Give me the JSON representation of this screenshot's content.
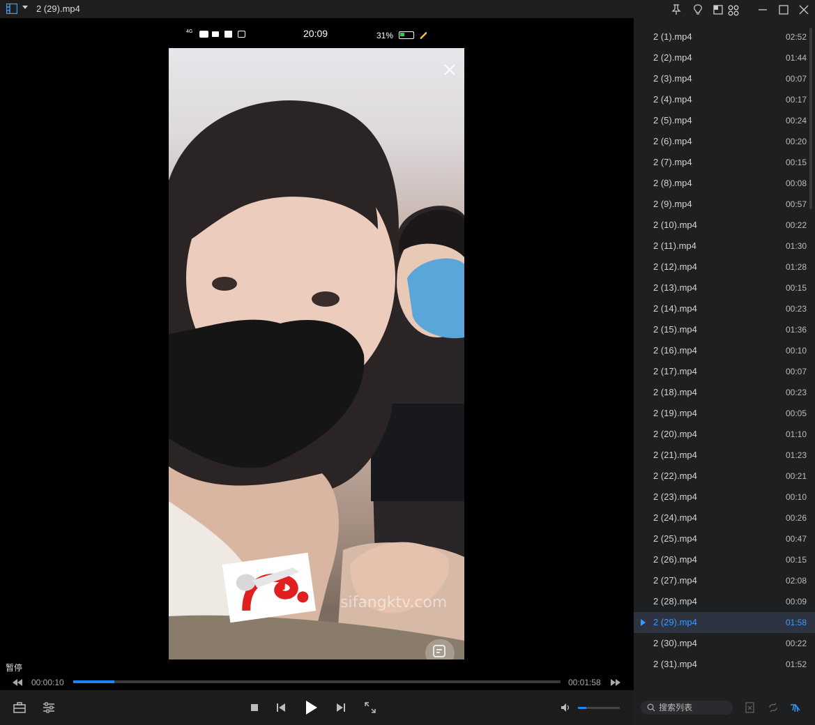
{
  "window": {
    "title": "2 (29).mp4"
  },
  "phone_status": {
    "network": "4G",
    "time": "20:09",
    "battery": "31%"
  },
  "video": {
    "watermark": "sifangktv.com"
  },
  "player": {
    "state_label": "暂停",
    "current_time": "00:00:10",
    "total_time": "00:01:58",
    "progress": 0.085,
    "volume": 0.2
  },
  "playlist": {
    "active_index": 28,
    "items": [
      {
        "name": "2 (1).mp4",
        "duration": "02:52"
      },
      {
        "name": "2 (2).mp4",
        "duration": "01:44"
      },
      {
        "name": "2 (3).mp4",
        "duration": "00:07"
      },
      {
        "name": "2 (4).mp4",
        "duration": "00:17"
      },
      {
        "name": "2 (5).mp4",
        "duration": "00:24"
      },
      {
        "name": "2 (6).mp4",
        "duration": "00:20"
      },
      {
        "name": "2 (7).mp4",
        "duration": "00:15"
      },
      {
        "name": "2 (8).mp4",
        "duration": "00:08"
      },
      {
        "name": "2 (9).mp4",
        "duration": "00:57"
      },
      {
        "name": "2 (10).mp4",
        "duration": "00:22"
      },
      {
        "name": "2 (11).mp4",
        "duration": "01:30"
      },
      {
        "name": "2 (12).mp4",
        "duration": "01:28"
      },
      {
        "name": "2 (13).mp4",
        "duration": "00:15"
      },
      {
        "name": "2 (14).mp4",
        "duration": "00:23"
      },
      {
        "name": "2 (15).mp4",
        "duration": "01:36"
      },
      {
        "name": "2 (16).mp4",
        "duration": "00:10"
      },
      {
        "name": "2 (17).mp4",
        "duration": "00:07"
      },
      {
        "name": "2 (18).mp4",
        "duration": "00:23"
      },
      {
        "name": "2 (19).mp4",
        "duration": "00:05"
      },
      {
        "name": "2 (20).mp4",
        "duration": "01:10"
      },
      {
        "name": "2 (21).mp4",
        "duration": "01:23"
      },
      {
        "name": "2 (22).mp4",
        "duration": "00:21"
      },
      {
        "name": "2 (23).mp4",
        "duration": "00:10"
      },
      {
        "name": "2 (24).mp4",
        "duration": "00:26"
      },
      {
        "name": "2 (25).mp4",
        "duration": "00:47"
      },
      {
        "name": "2 (26).mp4",
        "duration": "00:15"
      },
      {
        "name": "2 (27).mp4",
        "duration": "02:08"
      },
      {
        "name": "2 (28).mp4",
        "duration": "00:09"
      },
      {
        "name": "2 (29).mp4",
        "duration": "01:58"
      },
      {
        "name": "2 (30).mp4",
        "duration": "00:22"
      },
      {
        "name": "2 (31).mp4",
        "duration": "01:52"
      }
    ]
  },
  "search": {
    "placeholder": "搜索列表"
  },
  "colors": {
    "accent": "#3a9bff",
    "sidebar_bg": "#1e1f21",
    "bar_bg": "#1c1c1c"
  },
  "icons": {
    "titlebar": [
      "playlist-menu-icon",
      "dropdown-caret-icon"
    ],
    "sidebar_top": [
      "pin-icon",
      "lightbulb-icon",
      "mini-mode-icon",
      "apps-icon",
      "minimize-icon",
      "maximize-icon",
      "close-icon"
    ],
    "controls": [
      "open-file-icon",
      "settings-sliders-icon",
      "stop-icon",
      "previous-icon",
      "play-icon",
      "next-icon",
      "fullscreen-icon",
      "volume-icon"
    ],
    "sidebar_bottom": [
      "search-icon",
      "remove-item-icon",
      "loop-icon",
      "broom-icon"
    ]
  }
}
